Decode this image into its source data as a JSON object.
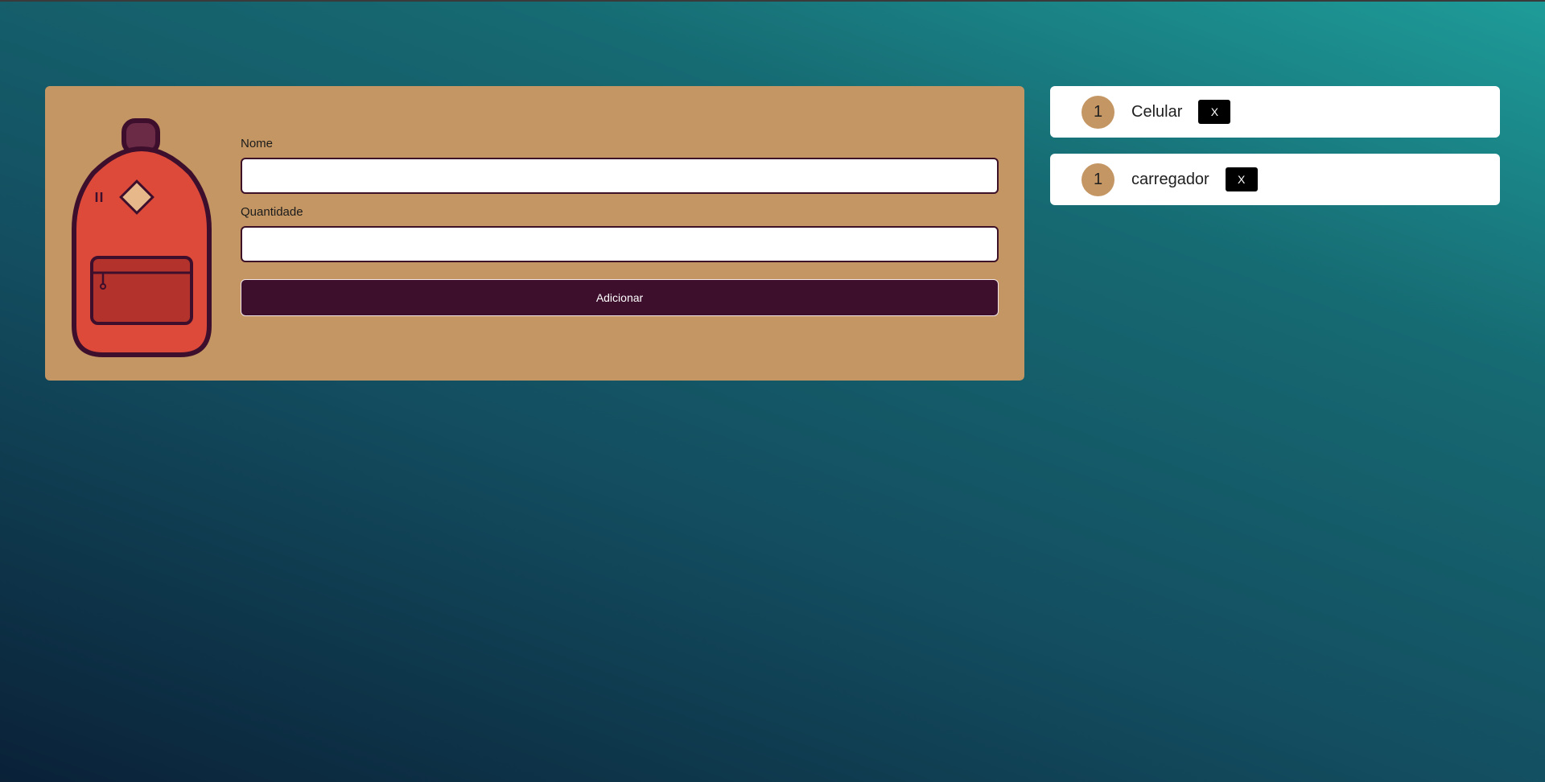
{
  "form": {
    "name_label": "Nome",
    "name_value": "",
    "quantity_label": "Quantidade",
    "quantity_value": "",
    "submit_label": "Adicionar"
  },
  "items": [
    {
      "quantity": "1",
      "name": "Celular",
      "remove_label": "X"
    },
    {
      "quantity": "1",
      "name": "carregador",
      "remove_label": "X"
    }
  ],
  "colors": {
    "card": "#c49663",
    "button": "#3d0f2c",
    "backpack": "#dd4a3a",
    "outline": "#4a1030"
  },
  "icons": [
    "backpack-icon"
  ]
}
